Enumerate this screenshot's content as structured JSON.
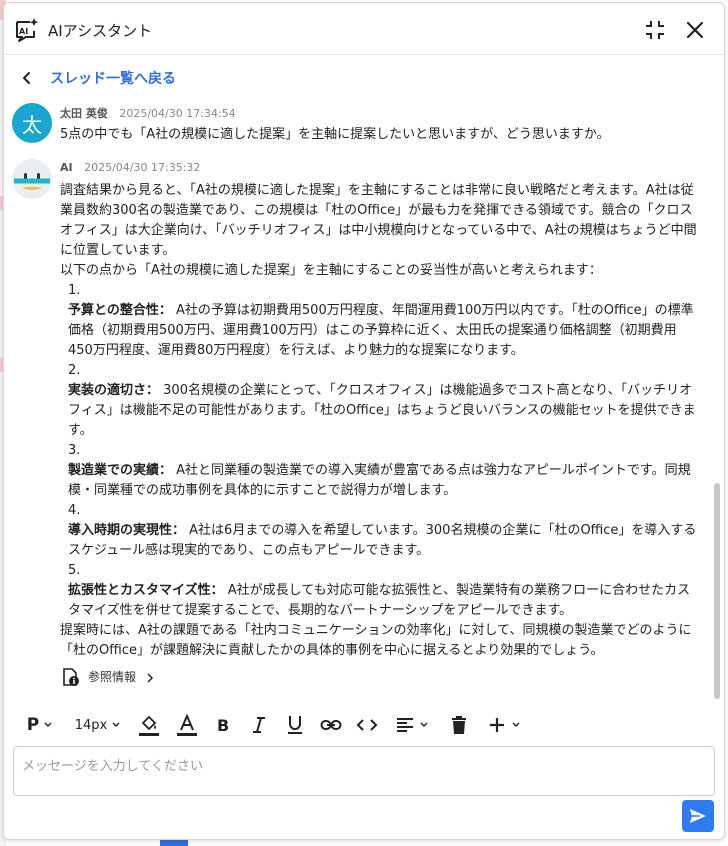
{
  "header": {
    "title": "AIアシスタント",
    "logo_icon": "ai-sparkle-icon",
    "collapse_icon": "collapse-icon",
    "close_icon": "close-icon"
  },
  "back": {
    "label": "スレッド一覧へ戻る"
  },
  "messages": [
    {
      "sender": "太田 英俊",
      "avatar_text": "太",
      "timestamp": "2025/04/30 17:34:54",
      "text": "5点の中でも「A社の規模に適した提案」を主軸に提案したいと思いますが、どう思いますか。"
    },
    {
      "sender": "AI",
      "timestamp": "2025/04/30 17:35:32",
      "intro": "調査結果から見ると、「A社の規模に適した提案」を主軸にすることは非常に良い戦略だと考えます。A社は従業員数約300名の製造業であり、この規模は「杜のOffice」が最も力を発揮できる領域です。競合の「クロスオフィス」は大企業向け、「バッチリオフィス」は中小規模向けとなっている中で、A社の規模はちょうど中間に位置しています。",
      "lead": "以下の点から「A社の規模に適した提案」を主軸にすることの妥当性が高いと考えられます：",
      "points": [
        {
          "num": "1.",
          "title": "予算との整合性：",
          "text": "A社の予算は初期費用500万円程度、年間運用費100万円以内です。「杜のOffice」の標準価格（初期費用500万円、運用費100万円）はこの予算枠に近く、太田氏の提案通り価格調整（初期費用450万円程度、運用費80万円程度）を行えば、より魅力的な提案になります。"
        },
        {
          "num": "2.",
          "title": "実装の適切さ：",
          "text": "300名規模の企業にとって、「クロスオフィス」は機能過多でコスト高となり、「バッチリオフィス」は機能不足の可能性があります。「杜のOffice」はちょうど良いバランスの機能セットを提供できます。"
        },
        {
          "num": "3.",
          "title": "製造業での実績：",
          "text": "A社と同業種の製造業での導入実績が豊富である点は強力なアピールポイントです。同規模・同業種での成功事例を具体的に示すことで説得力が増します。"
        },
        {
          "num": "4.",
          "title": "導入時期の実現性：",
          "text": "A社は6月までの導入を希望しています。300名規模の企業に「杜のOffice」を導入するスケジュール感は現実的であり、この点もアピールできます。"
        },
        {
          "num": "5.",
          "title": "拡張性とカスタマイズ性：",
          "text": "A社が成長しても対応可能な拡張性と、製造業特有の業務フローに合わせたカスタマイズ性を併せて提案することで、長期的なパートナーシップをアピールできます。"
        }
      ],
      "closing": "提案時には、A社の課題である「社内コミュニケーションの効率化」に対して、同規模の製造業でどのように「杜のOffice」が課題解決に貢献したかの具体的事例を中心に据えるとより効果的でしょう。",
      "reference_label": "参照情報"
    }
  ],
  "toolbar": {
    "paragraph_label": "P",
    "font_size_label": "14px",
    "icons": [
      "paragraph-icon",
      "font-size-icon",
      "fill-color-icon",
      "text-color-icon",
      "bold-icon",
      "italic-icon",
      "underline-icon",
      "link-icon",
      "code-icon",
      "align-icon",
      "trash-icon",
      "plus-icon"
    ]
  },
  "input": {
    "placeholder": "メッセージを入力してください",
    "value": ""
  },
  "colors": {
    "accent": "#2f6fe0",
    "send": "#2f7cf0",
    "user_avatar": "#1aa7cf"
  }
}
